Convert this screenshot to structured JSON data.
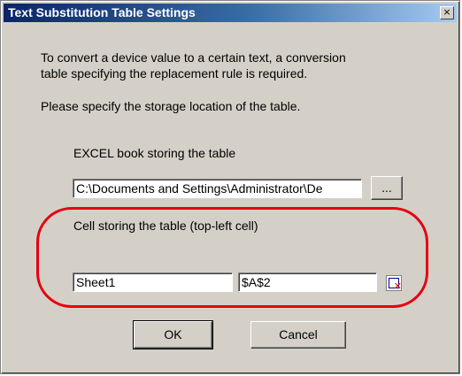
{
  "window": {
    "title": "Text Substitution Table Settings",
    "close_glyph": "×"
  },
  "intro": {
    "line1": "To convert a device value to a certain text, a conversion",
    "line2": "table specifying the replacement rule is required.",
    "line3": "Please specify the storage location of the table."
  },
  "excel": {
    "label": "EXCEL book storing the table",
    "path_value": "C:\\Documents and Settings\\Administrator\\De",
    "browse_label": "..."
  },
  "cell": {
    "label": "Cell storing the table (top-left cell)",
    "sheet_value": "Sheet1",
    "address_value": "$A$2",
    "picker_icon": "cell-select-icon"
  },
  "buttons": {
    "ok_label": "OK",
    "cancel_label": "Cancel"
  },
  "colors": {
    "highlight": "#e60012",
    "titlebar_start": "#0a246a",
    "dialog_bg": "#d4d0c8"
  }
}
